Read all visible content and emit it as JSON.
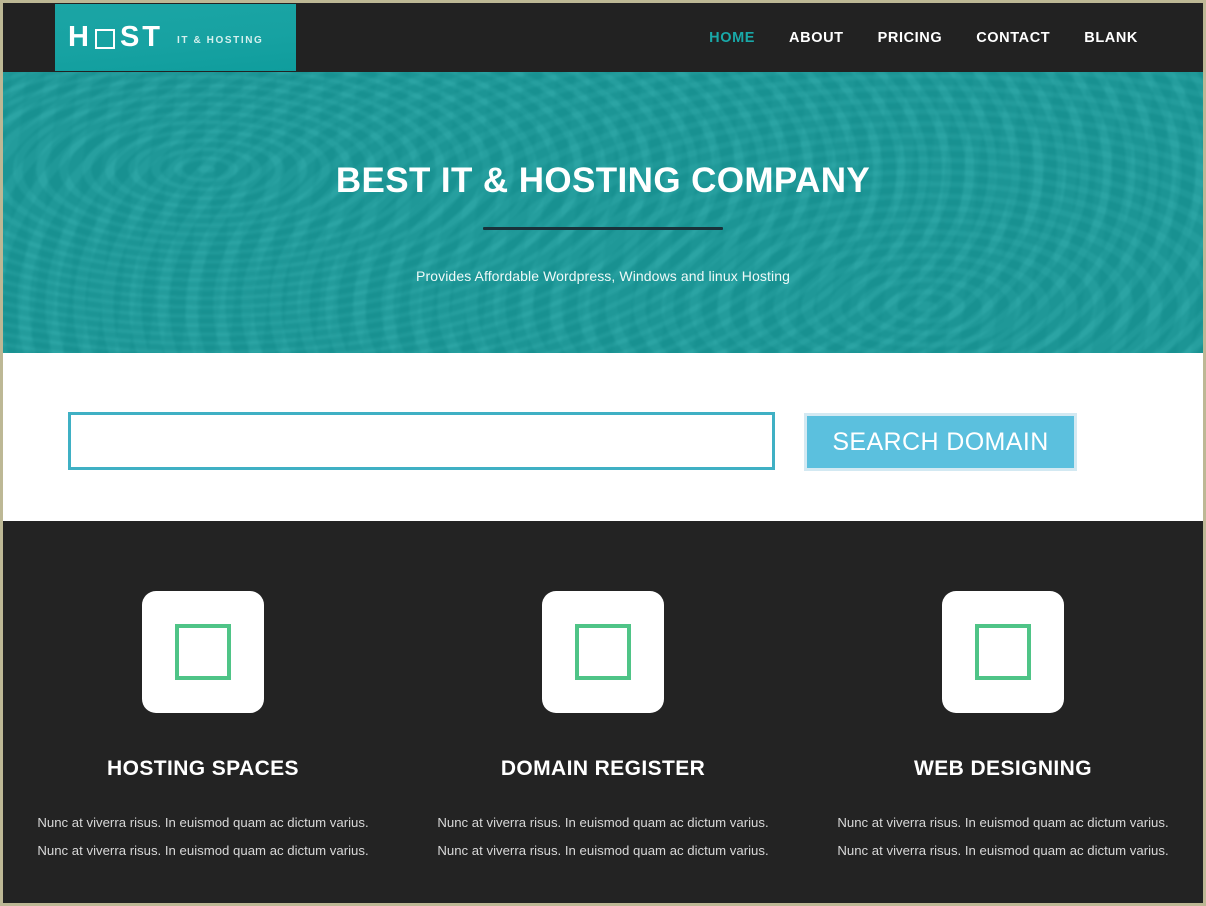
{
  "header": {
    "logo": {
      "text_before": "H",
      "missing_glyph_icon": "square-outline-icon",
      "text_after": "ST",
      "tagline": "IT & HOSTING"
    },
    "nav": [
      {
        "label": "HOME",
        "active": true
      },
      {
        "label": "ABOUT",
        "active": false
      },
      {
        "label": "PRICING",
        "active": false
      },
      {
        "label": "CONTACT",
        "active": false
      },
      {
        "label": "BLANK",
        "active": false
      }
    ]
  },
  "hero": {
    "title": "BEST IT & HOSTING COMPANY",
    "subtitle": "Provides Affordable Wordpress, Windows and linux Hosting"
  },
  "search": {
    "input_value": "",
    "placeholder": "",
    "button_label": "SEARCH DOMAIN"
  },
  "features": [
    {
      "icon": "square-outline-icon",
      "title": "HOSTING SPACES",
      "text": "Nunc at viverra risus. In euismod quam ac dictum varius. Nunc at viverra risus. In euismod quam ac dictum varius."
    },
    {
      "icon": "square-outline-icon",
      "title": "DOMAIN REGISTER",
      "text": "Nunc at viverra risus. In euismod quam ac dictum varius. Nunc at viverra risus. In euismod quam ac dictum varius."
    },
    {
      "icon": "square-outline-icon",
      "title": "WEB DESIGNING",
      "text": "Nunc at viverra risus. In euismod quam ac dictum varius. Nunc at viverra risus. In euismod quam ac dictum varius."
    }
  ],
  "colors": {
    "brand_teal": "#1aa3a3",
    "hero_teal": "#1a9d9d",
    "dark": "#222222",
    "dark_section": "#232323",
    "button_blue": "#5bc0de",
    "input_border": "#3fb0c4",
    "icon_green": "#4fc487",
    "page_border": "#bdb895",
    "nav_active": "#19a8a8"
  }
}
